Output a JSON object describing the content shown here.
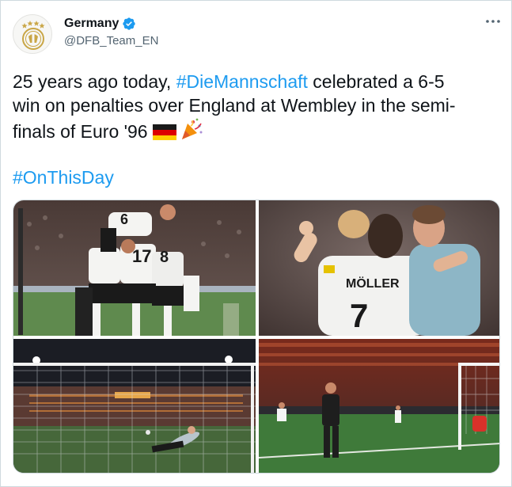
{
  "author": {
    "name": "Germany",
    "handle": "@DFB_Team_EN",
    "avatar_icon": "dfb-crest-icon",
    "verified_icon": "verified-badge-icon"
  },
  "more_icon": "more-options-icon",
  "tweet": {
    "line1_prefix": "25 years ago today, ",
    "line1_hashtag": "#DieMannschaft",
    "line1_suffix": " celebrated a 6-5",
    "line2": "win on penalties over England at Wembley in the semi-",
    "line3": "finals of Euro '96 ",
    "emojis": [
      "germany-flag-emoji",
      "party-popper-emoji"
    ],
    "hashtag2": "#OnThisDay"
  },
  "media": {
    "photo1": {
      "shirt_numbers": [
        "6",
        "17",
        "8"
      ],
      "description_icon": "team-celebration-photo"
    },
    "photo2": {
      "shirt_name": "MÖLLER",
      "shirt_number": "7",
      "description_icon": "players-embrace-photo"
    },
    "photo3": {
      "description_icon": "penalty-save-photo"
    },
    "photo4": {
      "description_icon": "penalty-kick-photo"
    }
  },
  "colors": {
    "accent": "#1d9bf0",
    "text": "#0f1419",
    "secondary": "#536471",
    "border": "#cfd9de"
  }
}
